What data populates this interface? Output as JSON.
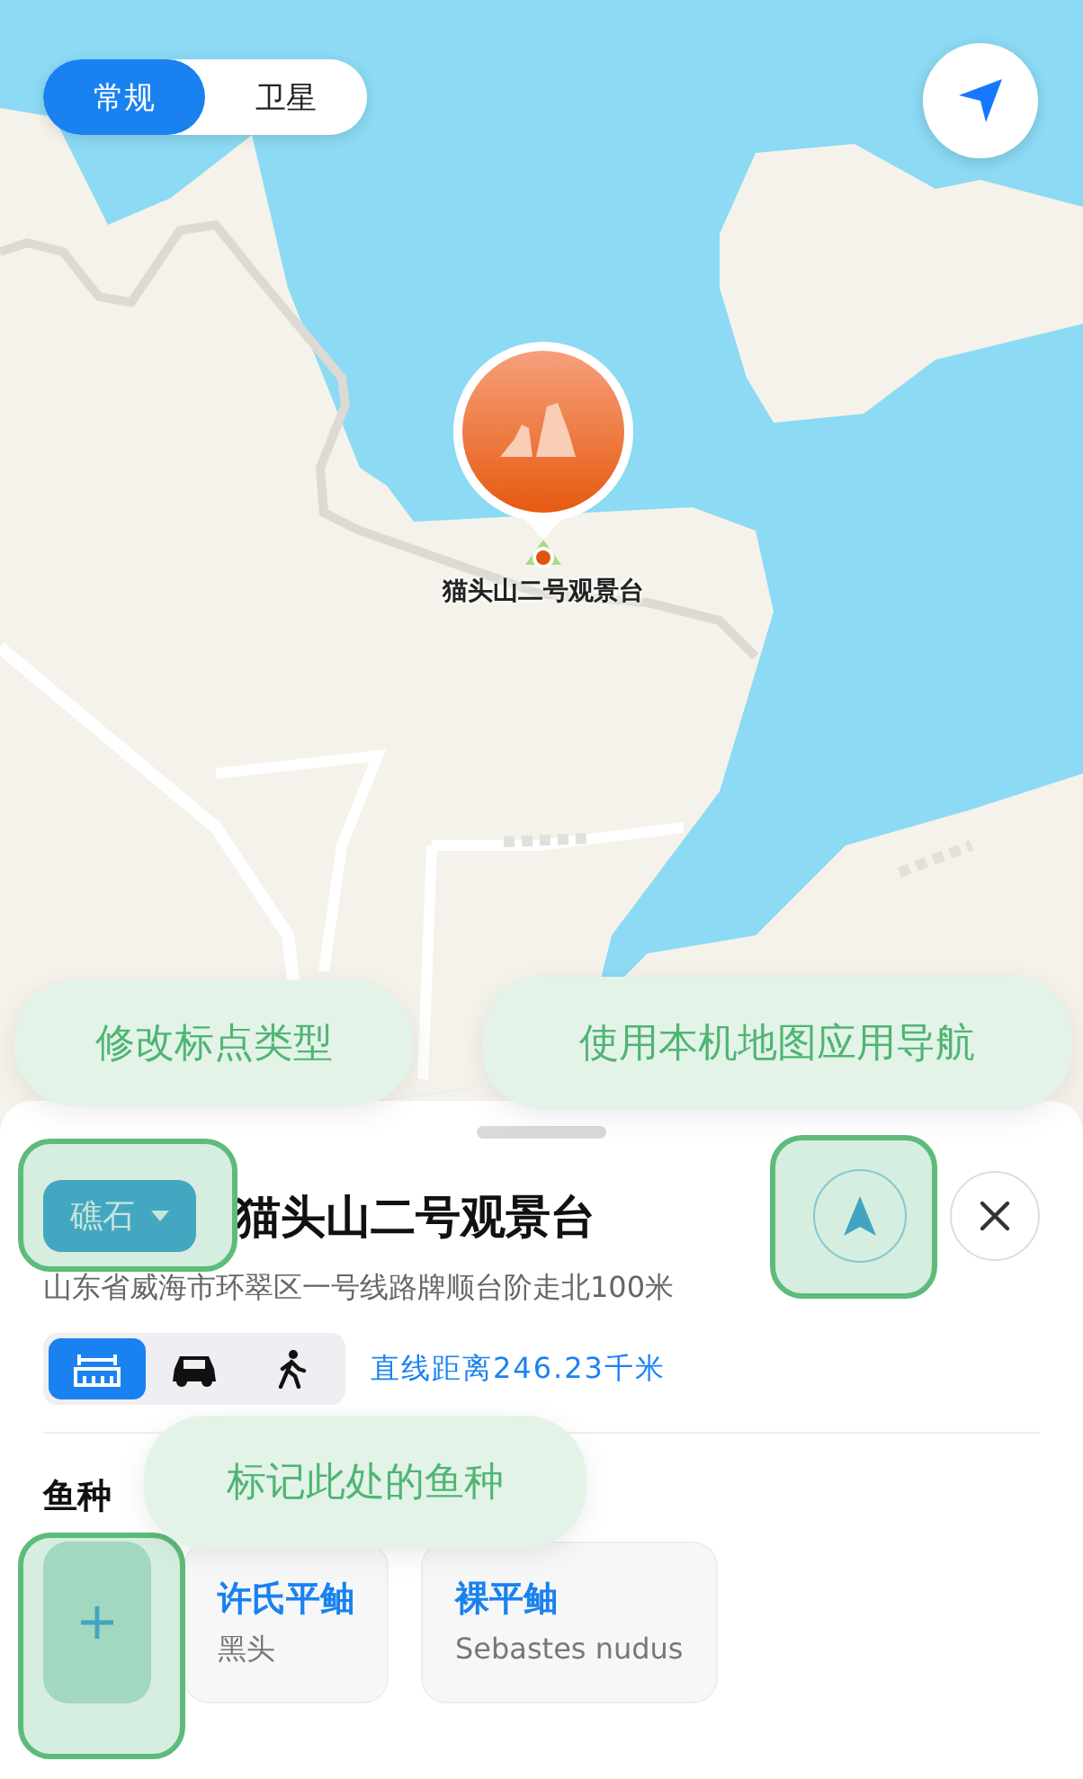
{
  "map_type_tabs": [
    {
      "label": "常规",
      "selected": true
    },
    {
      "label": "卫星",
      "selected": false
    }
  ],
  "map_marker": {
    "label": "猫头山二号观景台"
  },
  "place": {
    "type_chip": "礁石",
    "title": "猫头山二号观景台",
    "address": "山东省威海市环翠区一号线路牌顺台阶走北100米",
    "travel_modes": [
      {
        "kind": "straight",
        "selected": true
      },
      {
        "kind": "car",
        "selected": false
      },
      {
        "kind": "walk",
        "selected": false
      }
    ],
    "distance": "直线距离246.23千米"
  },
  "fish_section": {
    "title": "鱼种",
    "species": [
      {
        "name": "许氏平鲉",
        "subtitle": "黑头"
      },
      {
        "name": "裸平鲉",
        "subtitle": "Sebastes nudus"
      }
    ]
  },
  "guide_tips": [
    {
      "kind": "chip",
      "text": "修改标点类型"
    },
    {
      "kind": "navigate",
      "text": "使用本机地图应用导航"
    },
    {
      "kind": "add_fish",
      "text": "标记此处的鱼种"
    }
  ]
}
